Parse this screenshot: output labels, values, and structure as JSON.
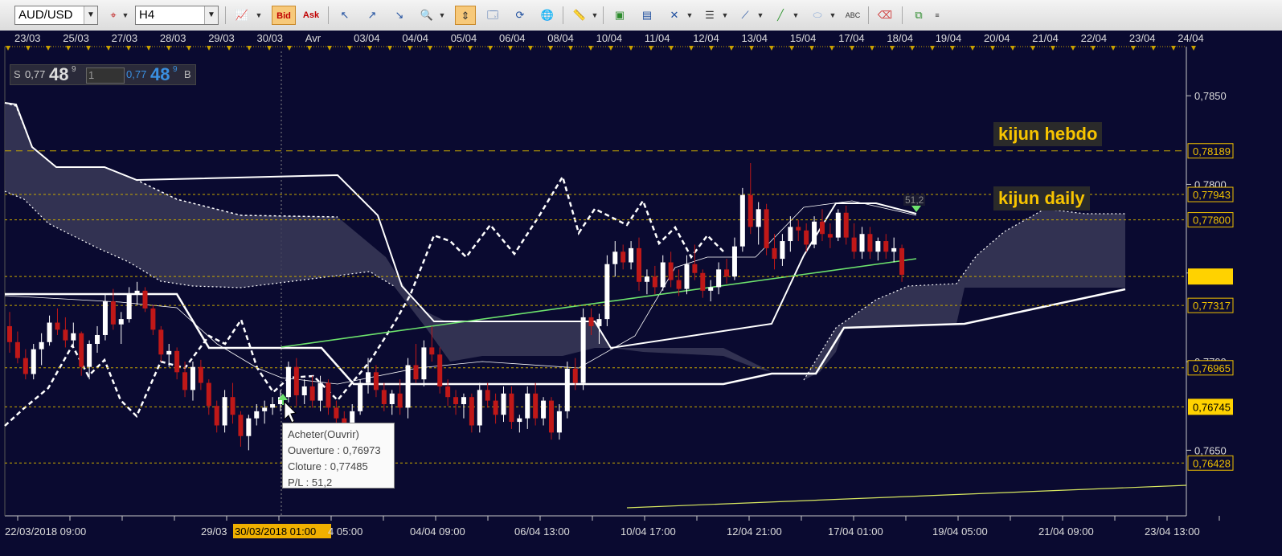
{
  "toolbar": {
    "symbol": "AUD/USD",
    "timeframe": "H4",
    "bid_label": "Bid",
    "ask_label": "Ask",
    "icons": [
      "chart-icon",
      "crosshair-icon",
      "cursor-icon",
      "cursor-icon",
      "zoom-icon",
      "period-separator-icon",
      "properties-icon",
      "refresh-icon",
      "globe-icon",
      "ruler-icon",
      "image-icon",
      "template-icon",
      "indicator-icon",
      "lines-icon",
      "fibonacci-icon",
      "trendline-icon",
      "ellipse-icon",
      "text-icon",
      "eraser-icon",
      "network-icon",
      "more-icon"
    ]
  },
  "pricebox": {
    "sell_label": "S",
    "sell_prefix": "0,77",
    "sell_big": "48",
    "sell_sup": "9",
    "lot": "1",
    "buy_prefix": "0,77",
    "buy_big": "48",
    "buy_sup": "9",
    "buy_label": "B"
  },
  "annotations": {
    "kijun_hebdo": "kijun hebdo",
    "kijun_daily": "kijun daily",
    "pl_marker": "51,2"
  },
  "tooltip": {
    "line1": "Acheter(Ouvrir)",
    "line2": "Ouverture : 0,76973",
    "line3": "Cloture : 0,77485",
    "line4": "P/L : 51,2"
  },
  "chart_data": {
    "type": "candlestick",
    "top_axis_labels": [
      "23/03",
      "25/03",
      "27/03",
      "28/03",
      "29/03",
      "30/03",
      "Avr",
      "03/04",
      "04/04",
      "05/04",
      "06/04",
      "08/04",
      "10/04",
      "11/04",
      "12/04",
      "13/04",
      "15/04",
      "17/04",
      "18/04",
      "19/04",
      "20/04",
      "21/04",
      "22/04",
      "23/04",
      "24/04"
    ],
    "bottom_axis_labels": [
      "22/03/2018 09:00",
      "29/03",
      "30/03/2018 01:00",
      "4 05:00",
      "04/04 09:00",
      "06/04 13:00",
      "10/04 17:00",
      "12/04 21:00",
      "17/04 01:00",
      "19/04 05:00",
      "21/04 09:00",
      "23/04 13:00"
    ],
    "y_ticks": [
      "0,7850",
      "0,7800",
      "0,7750",
      "0,7700",
      "0,7650"
    ],
    "highlighted_levels": [
      {
        "label": "0,78189",
        "value": 0.78189,
        "color": "#f0c000"
      },
      {
        "label": "0,77943",
        "value": 0.77943,
        "color": "#f0c000"
      },
      {
        "label": "0,77800",
        "value": 0.778,
        "color": "#f0c000"
      },
      {
        "label": "",
        "value": 0.7748,
        "color": "#ffd200",
        "filled": true
      },
      {
        "label": "0,77317",
        "value": 0.77317,
        "color": "#f0c000"
      },
      {
        "label": "0,76965",
        "value": 0.76965,
        "color": "#f0c000"
      },
      {
        "label": "0,76745",
        "value": 0.76745,
        "color": "#ffd200",
        "filled": true
      },
      {
        "label": "0,76428",
        "value": 0.76428,
        "color": "#f0c000"
      }
    ],
    "ylim": [
      0.7613,
      0.7875
    ],
    "candles": [
      [
        0.772,
        0.7728,
        0.7705,
        0.7711
      ],
      [
        0.7711,
        0.7717,
        0.7699,
        0.7702
      ],
      [
        0.7702,
        0.7707,
        0.769,
        0.7693
      ],
      [
        0.7693,
        0.771,
        0.769,
        0.7707
      ],
      [
        0.7707,
        0.7716,
        0.7698,
        0.7711
      ],
      [
        0.7711,
        0.7726,
        0.7709,
        0.7722
      ],
      [
        0.7722,
        0.773,
        0.7715,
        0.7718
      ],
      [
        0.7718,
        0.7725,
        0.7708,
        0.7712
      ],
      [
        0.7712,
        0.7722,
        0.7708,
        0.7716
      ],
      [
        0.7716,
        0.7717,
        0.7692,
        0.7697
      ],
      [
        0.7697,
        0.7712,
        0.769,
        0.771
      ],
      [
        0.771,
        0.772,
        0.7705,
        0.7715
      ],
      [
        0.7715,
        0.7738,
        0.7712,
        0.7734
      ],
      [
        0.7734,
        0.7741,
        0.7718,
        0.7721
      ],
      [
        0.7721,
        0.7728,
        0.771,
        0.7724
      ],
      [
        0.7724,
        0.7742,
        0.7722,
        0.7738
      ],
      [
        0.7738,
        0.7745,
        0.7732,
        0.774
      ],
      [
        0.774,
        0.7742,
        0.7728,
        0.773
      ],
      [
        0.773,
        0.7732,
        0.7715,
        0.7718
      ],
      [
        0.7718,
        0.772,
        0.77,
        0.7704
      ],
      [
        0.7704,
        0.771,
        0.7697,
        0.7706
      ],
      [
        0.7706,
        0.7708,
        0.769,
        0.7694
      ],
      [
        0.7694,
        0.77,
        0.768,
        0.7684
      ],
      [
        0.7684,
        0.77,
        0.7678,
        0.7697
      ],
      [
        0.7697,
        0.7701,
        0.7684,
        0.7688
      ],
      [
        0.7688,
        0.769,
        0.767,
        0.7675
      ],
      [
        0.7675,
        0.7678,
        0.766,
        0.7664
      ],
      [
        0.7664,
        0.7684,
        0.766,
        0.768
      ],
      [
        0.768,
        0.7688,
        0.7665,
        0.767
      ],
      [
        0.767,
        0.7672,
        0.7652,
        0.7658
      ],
      [
        0.7658,
        0.767,
        0.765,
        0.7668
      ],
      [
        0.7668,
        0.7676,
        0.7664,
        0.7672
      ],
      [
        0.7672,
        0.7678,
        0.7665,
        0.7674
      ],
      [
        0.7674,
        0.768,
        0.767,
        0.7676
      ],
      [
        0.7676,
        0.7684,
        0.7672,
        0.768
      ],
      [
        0.768,
        0.77,
        0.7677,
        0.7697
      ],
      [
        0.7697,
        0.7702,
        0.7675,
        0.7681
      ],
      [
        0.7681,
        0.769,
        0.7676,
        0.7686
      ],
      [
        0.7686,
        0.7692,
        0.7674,
        0.7678
      ],
      [
        0.7678,
        0.7692,
        0.7672,
        0.7688
      ],
      [
        0.7688,
        0.769,
        0.767,
        0.7674
      ],
      [
        0.7674,
        0.7678,
        0.7665,
        0.7668
      ],
      [
        0.7668,
        0.7672,
        0.7655,
        0.766
      ],
      [
        0.766,
        0.7676,
        0.7656,
        0.7672
      ],
      [
        0.7672,
        0.769,
        0.767,
        0.7688
      ],
      [
        0.7688,
        0.7702,
        0.7682,
        0.7694
      ],
      [
        0.7694,
        0.7698,
        0.768,
        0.7684
      ],
      [
        0.7684,
        0.7688,
        0.7672,
        0.7676
      ],
      [
        0.7676,
        0.7684,
        0.767,
        0.7682
      ],
      [
        0.7682,
        0.769,
        0.767,
        0.7674
      ],
      [
        0.7674,
        0.7702,
        0.7668,
        0.7698
      ],
      [
        0.7698,
        0.771,
        0.7688,
        0.769
      ],
      [
        0.769,
        0.7712,
        0.7686,
        0.7708
      ],
      [
        0.7708,
        0.772,
        0.77,
        0.7704
      ],
      [
        0.7704,
        0.7708,
        0.7682,
        0.7686
      ],
      [
        0.7686,
        0.769,
        0.7675,
        0.768
      ],
      [
        0.768,
        0.7684,
        0.767,
        0.7676
      ],
      [
        0.7676,
        0.7682,
        0.7668,
        0.768
      ],
      [
        0.768,
        0.7682,
        0.766,
        0.7664
      ],
      [
        0.7664,
        0.7688,
        0.766,
        0.7684
      ],
      [
        0.7684,
        0.7688,
        0.7674,
        0.7678
      ],
      [
        0.7678,
        0.7682,
        0.7665,
        0.767
      ],
      [
        0.767,
        0.7686,
        0.7666,
        0.7682
      ],
      [
        0.7682,
        0.7686,
        0.7662,
        0.7666
      ],
      [
        0.7666,
        0.767,
        0.766,
        0.7668
      ],
      [
        0.7668,
        0.7686,
        0.7662,
        0.7682
      ],
      [
        0.7682,
        0.7688,
        0.7664,
        0.7668
      ],
      [
        0.7668,
        0.768,
        0.7664,
        0.7678
      ],
      [
        0.7678,
        0.768,
        0.7656,
        0.766
      ],
      [
        0.766,
        0.7676,
        0.7656,
        0.7672
      ],
      [
        0.7672,
        0.77,
        0.7668,
        0.7696
      ],
      [
        0.7696,
        0.7702,
        0.7684,
        0.7688
      ],
      [
        0.7688,
        0.773,
        0.7684,
        0.7725
      ],
      [
        0.7725,
        0.773,
        0.7715,
        0.772
      ],
      [
        0.772,
        0.7727,
        0.771,
        0.7724
      ],
      [
        0.7724,
        0.776,
        0.772,
        0.7755
      ],
      [
        0.7755,
        0.7768,
        0.7748,
        0.7762
      ],
      [
        0.7762,
        0.7766,
        0.7752,
        0.7756
      ],
      [
        0.7756,
        0.7768,
        0.7752,
        0.7764
      ],
      [
        0.7764,
        0.777,
        0.774,
        0.7745
      ],
      [
        0.7745,
        0.7752,
        0.7738,
        0.7748
      ],
      [
        0.7748,
        0.7754,
        0.7738,
        0.7742
      ],
      [
        0.7742,
        0.776,
        0.774,
        0.7756
      ],
      [
        0.7756,
        0.7762,
        0.7742,
        0.7746
      ],
      [
        0.7746,
        0.7752,
        0.7737,
        0.7741
      ],
      [
        0.7741,
        0.776,
        0.7738,
        0.7755
      ],
      [
        0.7755,
        0.7766,
        0.7746,
        0.775
      ],
      [
        0.775,
        0.7752,
        0.7736,
        0.774
      ],
      [
        0.774,
        0.7746,
        0.7734,
        0.7742
      ],
      [
        0.7742,
        0.7756,
        0.7738,
        0.7752
      ],
      [
        0.7752,
        0.7758,
        0.7744,
        0.7748
      ],
      [
        0.7748,
        0.777,
        0.7746,
        0.7765
      ],
      [
        0.7765,
        0.7798,
        0.7762,
        0.7794
      ],
      [
        0.7794,
        0.7812,
        0.7772,
        0.7776
      ],
      [
        0.7776,
        0.779,
        0.7766,
        0.7786
      ],
      [
        0.7786,
        0.7789,
        0.776,
        0.7764
      ],
      [
        0.7764,
        0.7772,
        0.7752,
        0.7758
      ],
      [
        0.7758,
        0.7772,
        0.7754,
        0.7768
      ],
      [
        0.7768,
        0.7782,
        0.7762,
        0.7776
      ],
      [
        0.7776,
        0.778,
        0.7768,
        0.7774
      ],
      [
        0.7774,
        0.7778,
        0.7762,
        0.7766
      ],
      [
        0.7766,
        0.7782,
        0.7764,
        0.7779
      ],
      [
        0.7779,
        0.7786,
        0.7768,
        0.7772
      ],
      [
        0.7772,
        0.7778,
        0.7764,
        0.777
      ],
      [
        0.777,
        0.7786,
        0.7768,
        0.7784
      ],
      [
        0.7784,
        0.7788,
        0.7766,
        0.777
      ],
      [
        0.777,
        0.7778,
        0.7758,
        0.7762
      ],
      [
        0.7762,
        0.7776,
        0.7758,
        0.7772
      ],
      [
        0.7772,
        0.7776,
        0.7758,
        0.7762
      ],
      [
        0.7762,
        0.777,
        0.7757,
        0.7768
      ],
      [
        0.7768,
        0.7772,
        0.7758,
        0.7762
      ],
      [
        0.7762,
        0.777,
        0.7756,
        0.7764
      ],
      [
        0.7764,
        0.7766,
        0.7745,
        0.7749
      ]
    ],
    "pl": 51.2
  },
  "colors": {
    "background": "#0a0a30",
    "bull": "#ffffff",
    "bear": "#c01818",
    "cloud": "#3a3a58",
    "trendline": "#6de36d",
    "level": "#c8a800"
  }
}
